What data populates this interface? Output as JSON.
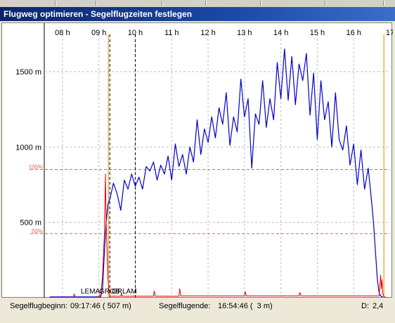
{
  "window": {
    "title": "Flugweg optimieren - Segelflugzeiten festlegen"
  },
  "status": {
    "start_label": "Segelflugbeginn:",
    "start_value": "09:17:46 ( 507 m)",
    "end_label": "Segelflugende:",
    "end_value": "16:54:46 (  3 m)",
    "d_label": "D:",
    "d_value": "2,4"
  },
  "colors": {
    "altitude_line": "#0000cc",
    "variometer_line": "#ee0000",
    "marker_orange": "#e08a00",
    "marker_red": "#ee2020",
    "grid": "#bdbdbd",
    "percent_line": "#e06060",
    "titlebar": "#0a246a"
  },
  "chart_data": {
    "type": "line",
    "x_unit": "h",
    "xlim": [
      7.5,
      17.0
    ],
    "ylim": [
      0,
      1700
    ],
    "x_ticks": [
      {
        "value": 8,
        "label": "08 h"
      },
      {
        "value": 9,
        "label": "09 h"
      },
      {
        "value": 10,
        "label": "10 h"
      },
      {
        "value": 11,
        "label": "11 h"
      },
      {
        "value": 12,
        "label": "12 h"
      },
      {
        "value": 13,
        "label": "13 h"
      },
      {
        "value": 14,
        "label": "14 h"
      },
      {
        "value": 15,
        "label": "15 h"
      },
      {
        "value": 16,
        "label": "16 h"
      },
      {
        "value": 17,
        "label": "17"
      }
    ],
    "y_ticks": [
      {
        "value": 500,
        "label": "500 m"
      },
      {
        "value": 1000,
        "label": "1000 m"
      },
      {
        "value": 1500,
        "label": "1500 m"
      }
    ],
    "percent_lines": [
      {
        "value": 850,
        "label": "100%"
      },
      {
        "value": 425,
        "label": "50%"
      }
    ],
    "markers": [
      {
        "x": 9.26,
        "color": "orange",
        "style": "solid"
      },
      {
        "x": 9.3,
        "color": "black",
        "style": "dashed"
      },
      {
        "x": 10.0,
        "color": "black",
        "style": "dashed"
      },
      {
        "x": 16.83,
        "color": "orange",
        "style": "solid"
      }
    ],
    "waypoints": [
      "LEMA",
      "GROB",
      "ORLAM"
    ],
    "grid": true,
    "series": [
      {
        "color": "blue",
        "x": [
          7.65,
          8.5,
          9.05,
          9.1,
          9.15,
          9.2,
          9.25,
          9.3,
          9.4,
          9.5,
          9.6,
          9.7,
          9.8,
          9.9,
          10.0,
          10.1,
          10.2,
          10.3,
          10.4,
          10.5,
          10.6,
          10.7,
          10.8,
          10.9,
          11.0,
          11.1,
          11.2,
          11.3,
          11.4,
          11.5,
          11.6,
          11.7,
          11.8,
          11.9,
          12.0,
          12.1,
          12.2,
          12.3,
          12.4,
          12.5,
          12.6,
          12.7,
          12.8,
          12.9,
          13.0,
          13.1,
          13.2,
          13.3,
          13.4,
          13.5,
          13.6,
          13.7,
          13.8,
          13.9,
          14.0,
          14.1,
          14.2,
          14.3,
          14.4,
          14.5,
          14.6,
          14.7,
          14.8,
          14.9,
          15.0,
          15.1,
          15.2,
          15.3,
          15.4,
          15.5,
          15.6,
          15.7,
          15.8,
          15.9,
          16.0,
          16.1,
          16.2,
          16.3,
          16.4,
          16.5,
          16.55,
          16.6,
          16.65,
          16.7,
          16.75,
          16.8
        ],
        "y": [
          5,
          5,
          5,
          60,
          300,
          500,
          620,
          650,
          760,
          690,
          580,
          780,
          720,
          820,
          740,
          800,
          720,
          870,
          840,
          900,
          780,
          880,
          820,
          940,
          780,
          1020,
          870,
          950,
          820,
          1000,
          900,
          1180,
          950,
          1120,
          1030,
          1200,
          1060,
          1260,
          1150,
          1360,
          1010,
          1200,
          1100,
          1450,
          1200,
          1320,
          860,
          1220,
          1150,
          1440,
          1130,
          1320,
          1180,
          1560,
          1320,
          1650,
          1310,
          1600,
          1280,
          1550,
          1440,
          1620,
          1210,
          1490,
          1050,
          1440,
          1180,
          1300,
          1000,
          1360,
          1050,
          980,
          1140,
          880,
          1020,
          750,
          980,
          720,
          860,
          620,
          480,
          300,
          120,
          30,
          10,
          5
        ]
      },
      {
        "color": "red",
        "x": [
          7.65,
          8.3,
          8.32,
          8.35,
          9.0,
          9.02,
          9.05,
          9.1,
          9.15,
          9.18,
          9.2,
          9.25,
          9.3,
          9.6,
          9.62,
          9.64,
          10.5,
          10.52,
          10.55,
          11.2,
          11.22,
          11.25,
          13.0,
          13.02,
          13.05,
          14.5,
          14.52,
          14.55,
          16.7,
          16.72,
          16.74,
          16.76,
          16.78,
          16.8,
          16.82,
          16.85,
          16.9
        ],
        "y": [
          2,
          2,
          25,
          2,
          2,
          20,
          2,
          150,
          420,
          820,
          500,
          120,
          10,
          10,
          30,
          10,
          10,
          45,
          10,
          10,
          60,
          12,
          12,
          40,
          12,
          12,
          35,
          12,
          12,
          80,
          150,
          60,
          120,
          30,
          10,
          5,
          2
        ]
      }
    ]
  }
}
